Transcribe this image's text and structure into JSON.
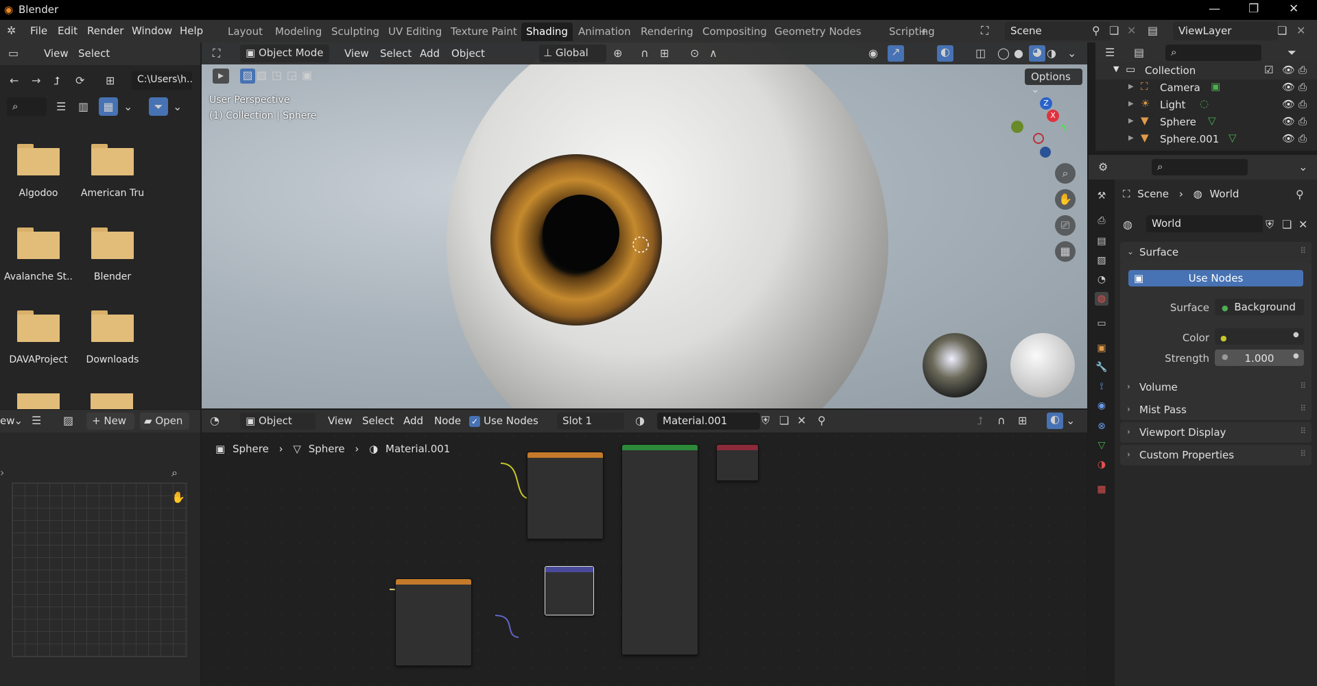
{
  "window": {
    "title": "Blender",
    "controls": [
      "—",
      "❐",
      "✕"
    ]
  },
  "menu": [
    "File",
    "Edit",
    "Render",
    "Window",
    "Help"
  ],
  "workspaces": [
    {
      "label": "Layout",
      "active": false
    },
    {
      "label": "Modeling",
      "active": false
    },
    {
      "label": "Sculpting",
      "active": false
    },
    {
      "label": "UV Editing",
      "active": false
    },
    {
      "label": "Texture Paint",
      "active": false
    },
    {
      "label": "Shading",
      "active": true
    },
    {
      "label": "Animation",
      "active": false
    },
    {
      "label": "Rendering",
      "active": false
    },
    {
      "label": "Compositing",
      "active": false
    },
    {
      "label": "Geometry Nodes",
      "active": false
    },
    {
      "label": "Scripting",
      "active": false
    }
  ],
  "add_workspace": "+",
  "scene": {
    "label": "Scene"
  },
  "view_layer": {
    "label": "ViewLayer"
  },
  "file_browser": {
    "menu": [
      "View",
      "Select"
    ],
    "path": "C:\\Users\\h...",
    "folders": [
      "Algodoo",
      "American Tru",
      "Avalanche St...",
      "Blender",
      "DAVAProject",
      "Downloads"
    ]
  },
  "viewport": {
    "mode": "Object Mode",
    "menu": [
      "View",
      "Select",
      "Add",
      "Object"
    ],
    "transform": "Global",
    "options": "Options",
    "overlay_line1": "User Perspective",
    "overlay_line2": "(1) Collection | Sphere",
    "gizmo": {
      "x": "X",
      "y": "Y",
      "z": "Z"
    }
  },
  "image_editor": {
    "view_label": "ew",
    "new": "New",
    "open": "Open"
  },
  "node_editor": {
    "mode": "Object",
    "menu": [
      "View",
      "Select",
      "Add",
      "Node"
    ],
    "use_nodes": "Use Nodes",
    "slot": "Slot 1",
    "material": "Material.001",
    "breadcrumb": [
      "Sphere",
      "Sphere",
      "Material.001"
    ]
  },
  "outliner": {
    "rows": [
      {
        "label": "Collection",
        "level": 0
      },
      {
        "label": "Camera",
        "level": 1
      },
      {
        "label": "Light",
        "level": 1
      },
      {
        "label": "Sphere",
        "level": 1
      },
      {
        "label": "Sphere.001",
        "level": 1
      }
    ]
  },
  "properties": {
    "breadcrumb": [
      "Scene",
      "World"
    ],
    "world_name": "World",
    "surface_panel": "Surface",
    "use_nodes": "Use Nodes",
    "surface_label": "Surface",
    "surface_value": "Background",
    "color_label": "Color",
    "strength_label": "Strength",
    "strength_value": "1.000",
    "panels": [
      "Volume",
      "Mist Pass",
      "Viewport Display",
      "Custom Properties"
    ]
  },
  "colors": {
    "accent": "#4772b3",
    "active_tab": "#1d1d1d",
    "folder": "#e2bd7a"
  }
}
